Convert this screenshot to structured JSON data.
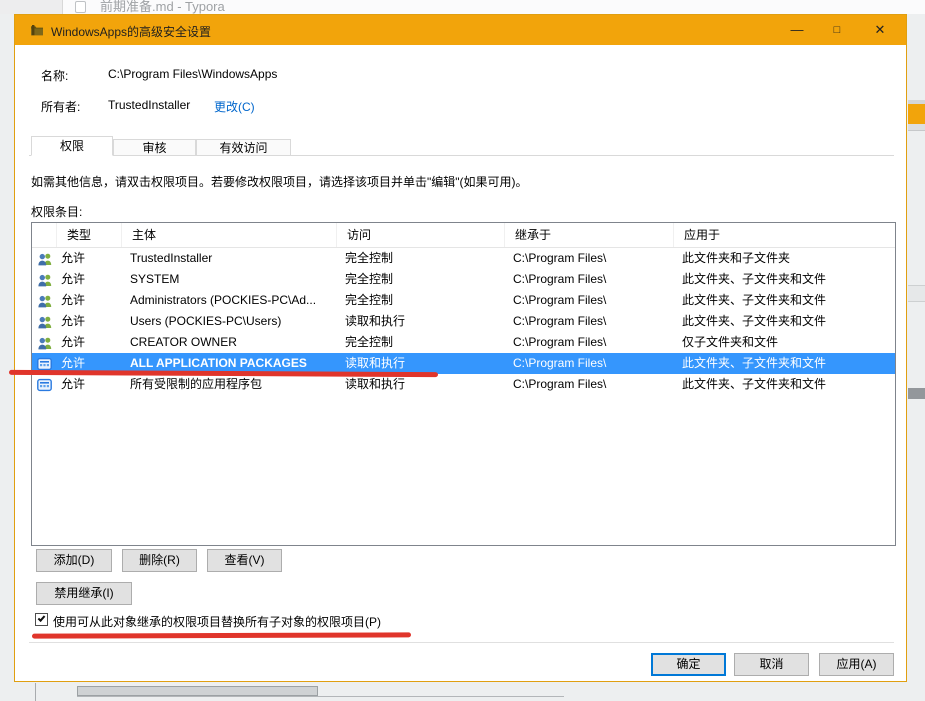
{
  "background": {
    "typora_title": "前期准备.md - Typora"
  },
  "window": {
    "title": "WindowsApps的高级安全设置",
    "controls": {
      "minimize": "—",
      "maximize": "□",
      "close": "✕"
    }
  },
  "fields": {
    "name_label": "名称:",
    "name_value": "C:\\Program Files\\WindowsApps",
    "owner_label": "所有者:",
    "owner_value": "TrustedInstaller",
    "owner_change_link": "更改(C)"
  },
  "tabs": [
    {
      "label": "权限",
      "active": true
    },
    {
      "label": "审核",
      "active": false
    },
    {
      "label": "有效访问",
      "active": false
    }
  ],
  "instruction": "如需其他信息，请双击权限项目。若要修改权限项目，请选择该项目并单击\"编辑\"(如果可用)。",
  "entries_label": "权限条目:",
  "table": {
    "columns": [
      "类型",
      "主体",
      "访问",
      "继承于",
      "应用于"
    ],
    "rows": [
      {
        "icon": "users-icon",
        "type": "允许",
        "principal": "TrustedInstaller",
        "access": "完全控制",
        "inherited_from": "C:\\Program Files\\",
        "applies_to": "此文件夹和子文件夹",
        "selected": false
      },
      {
        "icon": "users-icon",
        "type": "允许",
        "principal": "SYSTEM",
        "access": "完全控制",
        "inherited_from": "C:\\Program Files\\",
        "applies_to": "此文件夹、子文件夹和文件",
        "selected": false
      },
      {
        "icon": "users-icon",
        "type": "允许",
        "principal": "Administrators (POCKIES-PC\\Ad...",
        "access": "完全控制",
        "inherited_from": "C:\\Program Files\\",
        "applies_to": "此文件夹、子文件夹和文件",
        "selected": false
      },
      {
        "icon": "users-icon",
        "type": "允许",
        "principal": "Users (POCKIES-PC\\Users)",
        "access": "读取和执行",
        "inherited_from": "C:\\Program Files\\",
        "applies_to": "此文件夹、子文件夹和文件",
        "selected": false
      },
      {
        "icon": "users-icon",
        "type": "允许",
        "principal": "CREATOR OWNER",
        "access": "完全控制",
        "inherited_from": "C:\\Program Files\\",
        "applies_to": "仅子文件夹和文件",
        "selected": false
      },
      {
        "icon": "package-icon",
        "type": "允许",
        "principal": "ALL APPLICATION PACKAGES",
        "access": "读取和执行",
        "inherited_from": "C:\\Program Files\\",
        "applies_to": "此文件夹、子文件夹和文件",
        "selected": true
      },
      {
        "icon": "package-icon",
        "type": "允许",
        "principal": "所有受限制的应用程序包",
        "access": "读取和执行",
        "inherited_from": "C:\\Program Files\\",
        "applies_to": "此文件夹、子文件夹和文件",
        "selected": false
      }
    ]
  },
  "buttons": {
    "add": "添加(D)",
    "remove": "删除(R)",
    "view": "查看(V)",
    "disable_inheritance": "禁用继承(I)",
    "ok": "确定",
    "cancel": "取消",
    "apply": "应用(A)"
  },
  "checkbox": {
    "checked": true,
    "label": "使用可从此对象继承的权限项目替换所有子对象的权限项目(P)"
  },
  "colors": {
    "titlebar": "#f2a40b",
    "selection": "#3596fd",
    "annotation_red": "#e0352b",
    "link_blue": "#0066cc",
    "default_button_border": "#0078d7"
  }
}
